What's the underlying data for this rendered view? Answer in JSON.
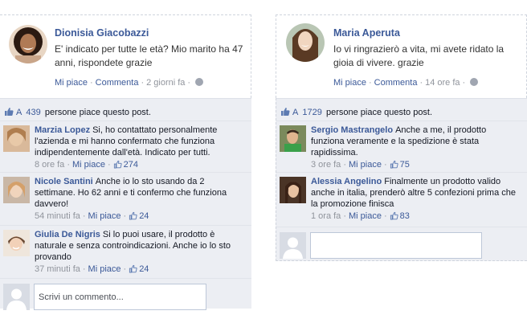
{
  "posts": [
    {
      "author": "Dionisia Giacobazzi",
      "text": "E' indicato per tutte le età? Mio marito ha 47 anni, rispondete grazie",
      "actions": {
        "like": "Mi piace",
        "comment": "Commenta",
        "time": "2 giorni fa"
      },
      "likes": {
        "prefix": "A",
        "count": "439",
        "suffix": "persone piace questo post."
      },
      "comments": [
        {
          "name": "Marzia Lopez",
          "text": "Si, ho contattato personalmente l'azienda e mi hanno confermato che funziona indipendentemente dall'età. Indicato per tutti.",
          "time": "8 ore fa",
          "like": "Mi piace",
          "likes": "274"
        },
        {
          "name": "Nicole Santini",
          "text": "Anche io lo sto usando da 2 settimane. Ho 62 anni e ti confermo che funziona davvero!",
          "time": "54 minuti fa",
          "like": "Mi piace",
          "likes": "24"
        },
        {
          "name": "Giulia De Nigris",
          "text": "Si lo puoi usare, il prodotto è naturale e senza controindicazioni. Anche io lo sto provando",
          "time": "37 minuti fa",
          "like": "Mi piace",
          "likes": "24"
        }
      ],
      "reply_placeholder": "Scrivi un commento..."
    },
    {
      "author": "Maria Aperuta",
      "text": "Io vi ringrazierò a vita, mi avete ridato la gioia di vivere. grazie",
      "actions": {
        "like": "Mi piace",
        "comment": "Commenta",
        "time": "14 ore fa"
      },
      "likes": {
        "prefix": "A",
        "count": "1729",
        "suffix": "persone piace questo post."
      },
      "comments": [
        {
          "name": "Sergio Mastrangelo",
          "text": "Anche a me, il prodotto funziona veramente e la spedizione è stata rapidissima.",
          "time": "3 ore fa",
          "like": "Mi piace",
          "likes": "75"
        },
        {
          "name": "Alessia Angelino",
          "text": "Finalmente un prodotto valido anche in italia, prenderò altre 5 confezioni prima che la promozione finisca",
          "time": "1 ora fa",
          "like": "Mi piace",
          "likes": "83"
        }
      ],
      "reply_placeholder": ""
    }
  ],
  "colors": {
    "link": "#3b5998",
    "meta": "#90949c",
    "comment_bg": "#eceef3"
  },
  "icons": [
    "like-thumb-icon",
    "globe-icon",
    "avatar-placeholder-icon"
  ]
}
